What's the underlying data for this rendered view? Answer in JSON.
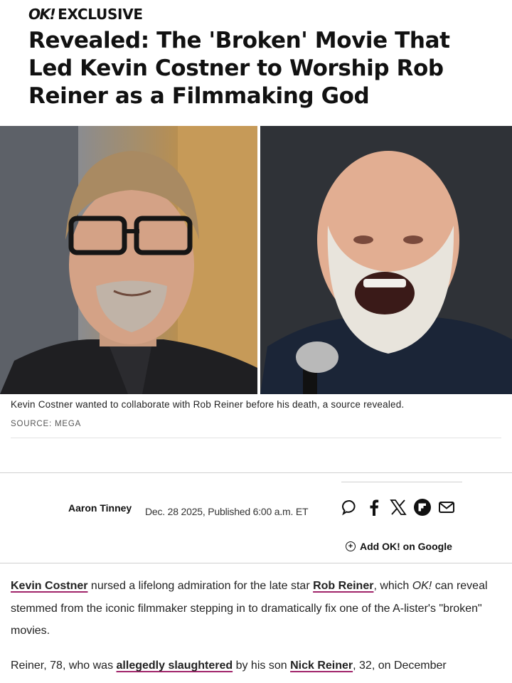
{
  "header": {
    "brand": "OK!",
    "kicker": "EXCLUSIVE",
    "headline": "Revealed: The 'Broken' Movie That Led Kevin Costner to Worship Rob Reiner as a Filmmaking God"
  },
  "hero": {
    "left_photo_alt": "Kevin Costner",
    "right_photo_alt": "Rob Reiner",
    "caption": "Kevin Costner wanted to collaborate with Rob Reiner before his death, a source revealed.",
    "source": "SOURCE: MEGA"
  },
  "byline": {
    "author": "Aaron Tinney",
    "date": "Dec. 28 2025, Published 6:00 a.m. ET",
    "share_icons": [
      "comment-icon",
      "facebook-icon",
      "x-icon",
      "flipboard-icon",
      "email-icon"
    ]
  },
  "add_google": "Add OK! on Google",
  "article": {
    "p1": {
      "link1": "Kevin Costner",
      "text1": " nursed a lifelong admiration for the late star ",
      "link2": "Rob Reiner",
      "text2": ", which ",
      "em": "OK!",
      "text3": " can reveal stemmed from the iconic filmmaker stepping in to dramatically fix one of the A-lister's \"broken\" movies."
    },
    "p2": {
      "text1": "Reiner, 78, who was ",
      "link1": "allegedly slaughtered",
      "text2": " by his son ",
      "link2": "Nick Reiner",
      "text3": ", 32, on December"
    }
  },
  "colors": {
    "link_underline": "#a0246a",
    "text": "#222222"
  }
}
